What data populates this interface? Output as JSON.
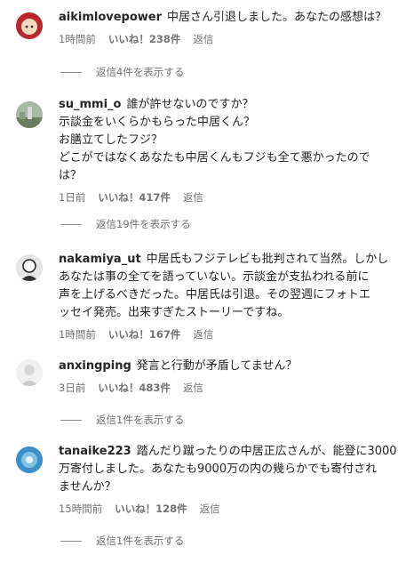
{
  "comments": [
    {
      "username": "aikimlovepower",
      "lines": [
        "中居さん引退しました。あなたの感想は？"
      ],
      "time": "1時間前",
      "likes": "いいね！238件",
      "reply": "返信",
      "view_replies": "返信4件を表示する",
      "avatar_icon": "anime-character-avatar-icon"
    },
    {
      "username": "su_mmi_o",
      "lines": [
        "誰が許せないのですか？",
        "示談金をいくらかもらった中居くん？",
        "お膳立てしたフジ？",
        "どこがではなくあなたも中居くんもフジも全て悪かったので",
        "は？"
      ],
      "time": "1日前",
      "likes": "いいね！417件",
      "reply": "返信",
      "view_replies": "返信19件を表示する",
      "avatar_icon": "landscape-photo-avatar-icon"
    },
    {
      "username": "nakamiya_ut",
      "lines": [
        "中居氏もフジテレビも批判されて当然。しかし",
        "あなたは事の全てを語っていない。示談金が支払われる前に",
        "声を上げるべきだった。中居氏は引退。その翌週にフォトエ",
        "ッセイ発売。出来すぎたストーリーですね。"
      ],
      "time": "1時間前",
      "likes": "いいね！167件",
      "reply": "返信",
      "view_replies": "",
      "avatar_icon": "sketch-portrait-avatar-icon"
    },
    {
      "username": "anxingping",
      "lines": [
        "発言と行動が矛盾してません？"
      ],
      "time": "3日前",
      "likes": "いいね！483件",
      "reply": "返信",
      "view_replies": "返信1件を表示する",
      "avatar_icon": "light-photo-avatar-icon"
    },
    {
      "username": "tanaike223",
      "lines": [
        "踏んだり蹴ったりの中居正広さんが、能登に3000",
        "万寄付しました。あなたも9000万の内の幾らかでも寄付され",
        "ませんか？"
      ],
      "time": "15時間前",
      "likes": "いいね！128件",
      "reply": "返信",
      "view_replies": "返信1件を表示する",
      "avatar_icon": "blue-photo-avatar-icon"
    }
  ]
}
